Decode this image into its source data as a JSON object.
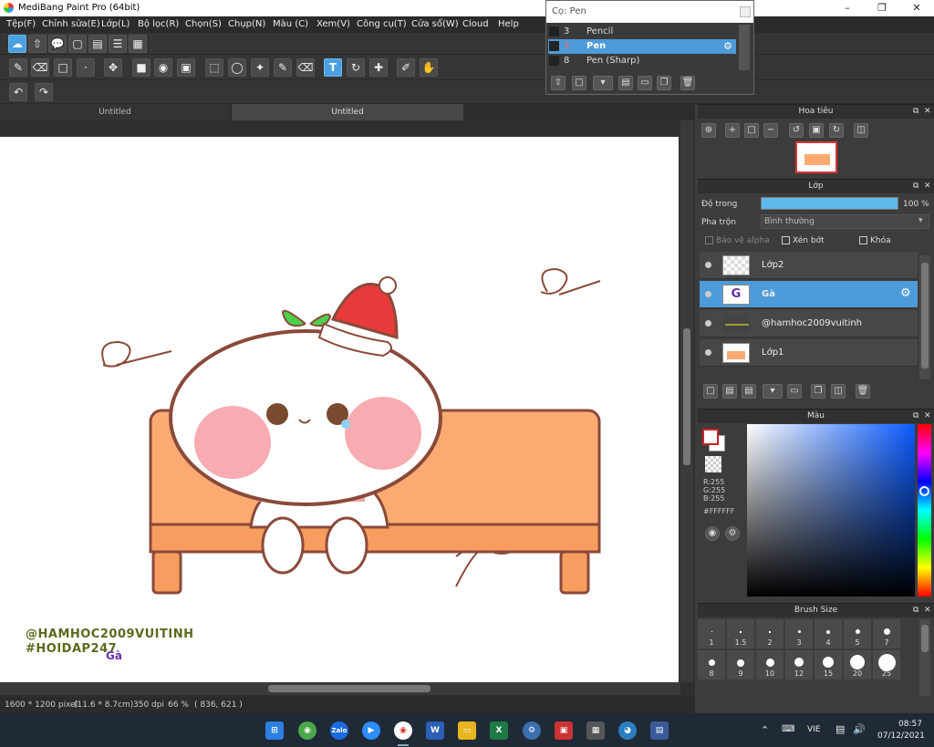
{
  "window": {
    "title": "MediBang Paint Pro (64bit)"
  },
  "menu": [
    "Tệp(F)",
    "Chỉnh sửa(E)",
    "Lớp(L)",
    "Bộ lọc(R)",
    "Chọn(S)",
    "Chụp(N)",
    "Màu (C)",
    "Xem(V)",
    "Công cụ(T)",
    "Cửa sổ(W)",
    "Cloud",
    "Help"
  ],
  "tabs": [
    "Untitled",
    "Untitled"
  ],
  "brush_popup": {
    "title": "Cọ: Pen",
    "items": [
      {
        "size": "3",
        "name": "Pencil"
      },
      {
        "size": "3",
        "name": "Pen"
      },
      {
        "size": "8",
        "name": "Pen (Sharp)"
      }
    ]
  },
  "navigator": {
    "title": "Hoa tiêu"
  },
  "layers": {
    "title": "Lớp",
    "opacity_label": "Độ trong",
    "opacity_value": "100 %",
    "opacity_fraction": 1.0,
    "blend_label": "Pha trộn",
    "blend_value": "Bình thường",
    "protect_alpha": "Bảo vệ alpha",
    "clipping": "Xén bớt",
    "lock": "Khóa",
    "items": [
      {
        "name": "Lớp2"
      },
      {
        "name": "Gà"
      },
      {
        "name": "@hamhoc2009vuitinh"
      },
      {
        "name": "Lớp1"
      }
    ]
  },
  "color": {
    "title": "Màu",
    "r": "R:255",
    "g": "G:255",
    "b": "B:255",
    "hex": "#FFFFFF"
  },
  "brush_size": {
    "title": "Brush Size",
    "sizes": [
      "1",
      "1.5",
      "2",
      "3",
      "4",
      "5",
      "7",
      "8",
      "9",
      "10",
      "12",
      "15",
      "20",
      "25"
    ]
  },
  "status": {
    "dimensions": "1600 * 1200 pixel",
    "physical": "(11.6 * 8.7cm)",
    "dpi": "350 dpi",
    "zoom": "66 %",
    "coords": "( 836, 621 )"
  },
  "canvas_text": {
    "line1": "@HAMHOC2009VUITINH",
    "line2": "#HOIDAP247",
    "name": "Gà"
  },
  "taskbar": {
    "lang": "VIE",
    "time": "08:57",
    "date": "07/12/2021"
  }
}
